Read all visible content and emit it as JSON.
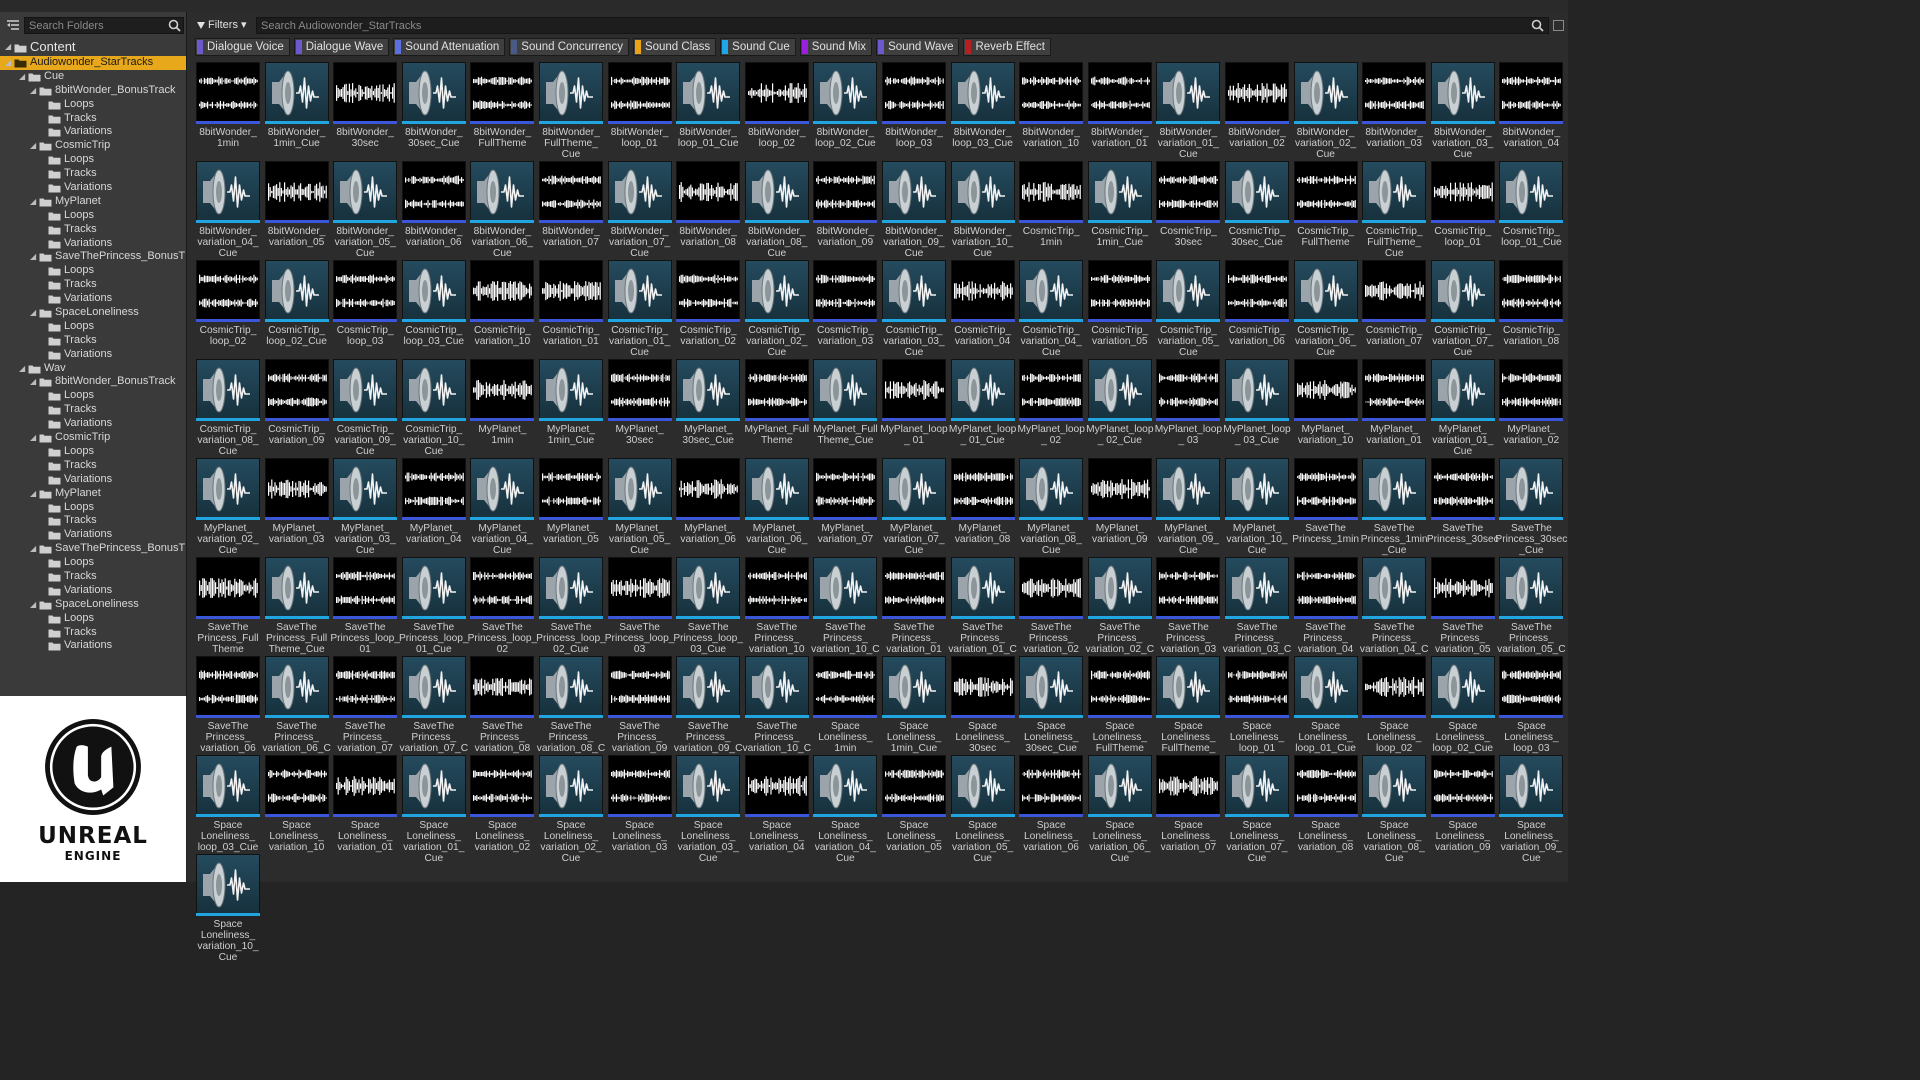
{
  "left_panel": {
    "search_placeholder": "Search Folders",
    "tree": [
      {
        "label": "Content",
        "level": 0,
        "expanded": true,
        "root": true
      },
      {
        "label": "Audiowonder_StarTracks",
        "level": 1,
        "expanded": true,
        "selected": true
      },
      {
        "label": "Cue",
        "level": 2,
        "expanded": true
      },
      {
        "label": "8bitWonder_BonusTrack",
        "level": 3,
        "expanded": true
      },
      {
        "label": "Loops",
        "level": 4
      },
      {
        "label": "Tracks",
        "level": 4
      },
      {
        "label": "Variations",
        "level": 4
      },
      {
        "label": "CosmicTrip",
        "level": 3,
        "expanded": true
      },
      {
        "label": "Loops",
        "level": 4
      },
      {
        "label": "Tracks",
        "level": 4
      },
      {
        "label": "Variations",
        "level": 4
      },
      {
        "label": "MyPlanet",
        "level": 3,
        "expanded": true
      },
      {
        "label": "Loops",
        "level": 4
      },
      {
        "label": "Tracks",
        "level": 4
      },
      {
        "label": "Variations",
        "level": 4
      },
      {
        "label": "SaveThePrincess_BonusT",
        "level": 3,
        "expanded": true
      },
      {
        "label": "Loops",
        "level": 4
      },
      {
        "label": "Tracks",
        "level": 4
      },
      {
        "label": "Variations",
        "level": 4
      },
      {
        "label": "SpaceLoneliness",
        "level": 3,
        "expanded": true
      },
      {
        "label": "Loops",
        "level": 4
      },
      {
        "label": "Tracks",
        "level": 4
      },
      {
        "label": "Variations",
        "level": 4
      },
      {
        "label": "Wav",
        "level": 2,
        "expanded": true
      },
      {
        "label": "8bitWonder_BonusTrack",
        "level": 3,
        "expanded": true
      },
      {
        "label": "Loops",
        "level": 4
      },
      {
        "label": "Tracks",
        "level": 4
      },
      {
        "label": "Variations",
        "level": 4
      },
      {
        "label": "CosmicTrip",
        "level": 3,
        "expanded": true
      },
      {
        "label": "Loops",
        "level": 4
      },
      {
        "label": "Tracks",
        "level": 4
      },
      {
        "label": "Variations",
        "level": 4
      },
      {
        "label": "MyPlanet",
        "level": 3,
        "expanded": true
      },
      {
        "label": "Loops",
        "level": 4
      },
      {
        "label": "Tracks",
        "level": 4
      },
      {
        "label": "Variations",
        "level": 4
      },
      {
        "label": "SaveThePrincess_BonusT",
        "level": 3,
        "expanded": true
      },
      {
        "label": "Loops",
        "level": 4
      },
      {
        "label": "Tracks",
        "level": 4
      },
      {
        "label": "Variations",
        "level": 4
      },
      {
        "label": "SpaceLoneliness",
        "level": 3,
        "expanded": true
      },
      {
        "label": "Loops",
        "level": 4
      },
      {
        "label": "Tracks",
        "level": 4
      },
      {
        "label": "Variations",
        "level": 4
      }
    ]
  },
  "logo": {
    "line1": "UNREAL",
    "line2": "ENGINE"
  },
  "toolbar": {
    "filters_label": "Filters",
    "search_placeholder": "Search Audiowonder_StarTracks"
  },
  "filter_chips": [
    {
      "label": "Dialogue Voice",
      "color": "#6a5acd"
    },
    {
      "label": "Dialogue Wave",
      "color": "#6a5acd"
    },
    {
      "label": "Sound Attenuation",
      "color": "#5b6fe0"
    },
    {
      "label": "Sound Concurrency",
      "color": "#4a5a86"
    },
    {
      "label": "Sound Class",
      "color": "#e8a317"
    },
    {
      "label": "Sound Cue",
      "color": "#1fa7e8"
    },
    {
      "label": "Sound Mix",
      "color": "#9b1fe0"
    },
    {
      "label": "Sound Wave",
      "color": "#6a5acd"
    },
    {
      "label": "Reverb Effect",
      "color": "#b41f1f"
    }
  ],
  "assets": [
    {
      "name": "8bitWonder_ 1min",
      "type": "wave"
    },
    {
      "name": "8bitWonder_ 1min_Cue",
      "type": "cue"
    },
    {
      "name": "8bitWonder_ 30sec",
      "type": "wave"
    },
    {
      "name": "8bitWonder_ 30sec_Cue",
      "type": "cue"
    },
    {
      "name": "8bitWonder_ FullTheme",
      "type": "wave"
    },
    {
      "name": "8bitWonder_ FullTheme_ Cue",
      "type": "cue"
    },
    {
      "name": "8bitWonder_ loop_01",
      "type": "wave"
    },
    {
      "name": "8bitWonder_ loop_01_Cue",
      "type": "cue"
    },
    {
      "name": "8bitWonder_ loop_02",
      "type": "wave"
    },
    {
      "name": "8bitWonder_ loop_02_Cue",
      "type": "cue"
    },
    {
      "name": "8bitWonder_ loop_03",
      "type": "wave"
    },
    {
      "name": "8bitWonder_ loop_03_Cue",
      "type": "cue"
    },
    {
      "name": "8bitWonder_ variation_10",
      "type": "wave"
    },
    {
      "name": "8bitWonder_ variation_01",
      "type": "wave"
    },
    {
      "name": "8bitWonder_ variation_01_ Cue",
      "type": "cue"
    },
    {
      "name": "8bitWonder_ variation_02",
      "type": "wave"
    },
    {
      "name": "8bitWonder_ variation_02_ Cue",
      "type": "cue"
    },
    {
      "name": "8bitWonder_ variation_03",
      "type": "wave"
    },
    {
      "name": "8bitWonder_ variation_03_ Cue",
      "type": "cue"
    },
    {
      "name": "8bitWonder_ variation_04",
      "type": "wave"
    },
    {
      "name": "8bitWonder_ variation_04_ Cue",
      "type": "cue"
    },
    {
      "name": "8bitWonder_ variation_05",
      "type": "wave"
    },
    {
      "name": "8bitWonder_ variation_05_ Cue",
      "type": "cue"
    },
    {
      "name": "8bitWonder_ variation_06",
      "type": "wave"
    },
    {
      "name": "8bitWonder_ variation_06_ Cue",
      "type": "cue"
    },
    {
      "name": "8bitWonder_ variation_07",
      "type": "wave"
    },
    {
      "name": "8bitWonder_ variation_07_ Cue",
      "type": "cue"
    },
    {
      "name": "8bitWonder_ variation_08",
      "type": "wave"
    },
    {
      "name": "8bitWonder_ variation_08_ Cue",
      "type": "cue"
    },
    {
      "name": "8bitWonder_ variation_09",
      "type": "wave"
    },
    {
      "name": "8bitWonder_ variation_09_ Cue",
      "type": "cue"
    },
    {
      "name": "8bitWonder_ variation_10_ Cue",
      "type": "cue"
    },
    {
      "name": "CosmicTrip_ 1min",
      "type": "wave"
    },
    {
      "name": "CosmicTrip_ 1min_Cue",
      "type": "cue"
    },
    {
      "name": "CosmicTrip_ 30sec",
      "type": "wave"
    },
    {
      "name": "CosmicTrip_ 30sec_Cue",
      "type": "cue"
    },
    {
      "name": "CosmicTrip_ FullTheme",
      "type": "wave"
    },
    {
      "name": "CosmicTrip_ FullTheme_ Cue",
      "type": "cue"
    },
    {
      "name": "CosmicTrip_ loop_01",
      "type": "wave"
    },
    {
      "name": "CosmicTrip_ loop_01_Cue",
      "type": "cue"
    },
    {
      "name": "CosmicTrip_ loop_02",
      "type": "wave"
    },
    {
      "name": "CosmicTrip_ loop_02_Cue",
      "type": "cue"
    },
    {
      "name": "CosmicTrip_ loop_03",
      "type": "wave"
    },
    {
      "name": "CosmicTrip_ loop_03_Cue",
      "type": "cue"
    },
    {
      "name": "CosmicTrip_ variation_10",
      "type": "wave"
    },
    {
      "name": "CosmicTrip_ variation_01",
      "type": "wave"
    },
    {
      "name": "CosmicTrip_ variation_01_ Cue",
      "type": "cue"
    },
    {
      "name": "CosmicTrip_ variation_02",
      "type": "wave"
    },
    {
      "name": "CosmicTrip_ variation_02_ Cue",
      "type": "cue"
    },
    {
      "name": "CosmicTrip_ variation_03",
      "type": "wave"
    },
    {
      "name": "CosmicTrip_ variation_03_ Cue",
      "type": "cue"
    },
    {
      "name": "CosmicTrip_ variation_04",
      "type": "wave"
    },
    {
      "name": "CosmicTrip_ variation_04_ Cue",
      "type": "cue"
    },
    {
      "name": "CosmicTrip_ variation_05",
      "type": "wave"
    },
    {
      "name": "CosmicTrip_ variation_05_ Cue",
      "type": "cue"
    },
    {
      "name": "CosmicTrip_ variation_06",
      "type": "wave"
    },
    {
      "name": "CosmicTrip_ variation_06_ Cue",
      "type": "cue"
    },
    {
      "name": "CosmicTrip_ variation_07",
      "type": "wave"
    },
    {
      "name": "CosmicTrip_ variation_07_ Cue",
      "type": "cue"
    },
    {
      "name": "CosmicTrip_ variation_08",
      "type": "wave"
    },
    {
      "name": "CosmicTrip_ variation_08_ Cue",
      "type": "cue"
    },
    {
      "name": "CosmicTrip_ variation_09",
      "type": "wave"
    },
    {
      "name": "CosmicTrip_ variation_09_ Cue",
      "type": "cue"
    },
    {
      "name": "CosmicTrip_ variation_10_ Cue",
      "type": "cue"
    },
    {
      "name": "MyPlanet_ 1min",
      "type": "wave"
    },
    {
      "name": "MyPlanet_ 1min_Cue",
      "type": "cue"
    },
    {
      "name": "MyPlanet_ 30sec",
      "type": "wave"
    },
    {
      "name": "MyPlanet_ 30sec_Cue",
      "type": "cue"
    },
    {
      "name": "MyPlanet_Full Theme",
      "type": "wave"
    },
    {
      "name": "MyPlanet_Full Theme_Cue",
      "type": "cue"
    },
    {
      "name": "MyPlanet_loop_ 01",
      "type": "wave"
    },
    {
      "name": "MyPlanet_loop_ 01_Cue",
      "type": "cue"
    },
    {
      "name": "MyPlanet_loop_ 02",
      "type": "wave"
    },
    {
      "name": "MyPlanet_loop_ 02_Cue",
      "type": "cue"
    },
    {
      "name": "MyPlanet_loop_ 03",
      "type": "wave"
    },
    {
      "name": "MyPlanet_loop_ 03_Cue",
      "type": "cue"
    },
    {
      "name": "MyPlanet_ variation_10",
      "type": "wave"
    },
    {
      "name": "MyPlanet_ variation_01",
      "type": "wave"
    },
    {
      "name": "MyPlanet_ variation_01_ Cue",
      "type": "cue"
    },
    {
      "name": "MyPlanet_ variation_02",
      "type": "wave"
    },
    {
      "name": "MyPlanet_ variation_02_ Cue",
      "type": "cue"
    },
    {
      "name": "MyPlanet_ variation_03",
      "type": "wave"
    },
    {
      "name": "MyPlanet_ variation_03_ Cue",
      "type": "cue"
    },
    {
      "name": "MyPlanet_ variation_04",
      "type": "wave"
    },
    {
      "name": "MyPlanet_ variation_04_ Cue",
      "type": "cue"
    },
    {
      "name": "MyPlanet_ variation_05",
      "type": "wave"
    },
    {
      "name": "MyPlanet_ variation_05_ Cue",
      "type": "cue"
    },
    {
      "name": "MyPlanet_ variation_06",
      "type": "wave"
    },
    {
      "name": "MyPlanet_ variation_06_ Cue",
      "type": "cue"
    },
    {
      "name": "MyPlanet_ variation_07",
      "type": "wave"
    },
    {
      "name": "MyPlanet_ variation_07_ Cue",
      "type": "cue"
    },
    {
      "name": "MyPlanet_ variation_08",
      "type": "wave"
    },
    {
      "name": "MyPlanet_ variation_08_ Cue",
      "type": "cue"
    },
    {
      "name": "MyPlanet_ variation_09",
      "type": "wave"
    },
    {
      "name": "MyPlanet_ variation_09_ Cue",
      "type": "cue"
    },
    {
      "name": "MyPlanet_ variation_10_ Cue",
      "type": "cue"
    },
    {
      "name": "SaveThe Princess_1min",
      "type": "wave"
    },
    {
      "name": "SaveThe Princess_1min _Cue",
      "type": "cue"
    },
    {
      "name": "SaveThe Princess_30sec",
      "type": "wave"
    },
    {
      "name": "SaveThe Princess_30sec _Cue",
      "type": "cue"
    },
    {
      "name": "SaveThe Princess_Full Theme",
      "type": "wave"
    },
    {
      "name": "SaveThe Princess_Full Theme_Cue",
      "type": "cue"
    },
    {
      "name": "SaveThe Princess_loop_ 01",
      "type": "wave"
    },
    {
      "name": "SaveThe Princess_loop_ 01_Cue",
      "type": "cue"
    },
    {
      "name": "SaveThe Princess_loop_ 02",
      "type": "wave"
    },
    {
      "name": "SaveThe Princess_loop_ 02_Cue",
      "type": "cue"
    },
    {
      "name": "SaveThe Princess_loop_ 03",
      "type": "wave"
    },
    {
      "name": "SaveThe Princess_loop_ 03_Cue",
      "type": "cue"
    },
    {
      "name": "SaveThe Princess_ variation_10",
      "type": "wave"
    },
    {
      "name": "SaveThe Princess_ variation_10_Cue",
      "type": "cue"
    },
    {
      "name": "SaveThe Princess_ variation_01",
      "type": "wave"
    },
    {
      "name": "SaveThe Princess_ variation_01_Cue",
      "type": "cue"
    },
    {
      "name": "SaveThe Princess_ variation_02",
      "type": "wave"
    },
    {
      "name": "SaveThe Princess_ variation_02_Cue",
      "type": "cue"
    },
    {
      "name": "SaveThe Princess_ variation_03",
      "type": "wave"
    },
    {
      "name": "SaveThe Princess_ variation_03_Cue",
      "type": "cue"
    },
    {
      "name": "SaveThe Princess_ variation_04",
      "type": "wave"
    },
    {
      "name": "SaveThe Princess_ variation_04_Cue",
      "type": "cue"
    },
    {
      "name": "SaveThe Princess_ variation_05",
      "type": "wave"
    },
    {
      "name": "SaveThe Princess_ variation_05_Cue",
      "type": "cue"
    },
    {
      "name": "SaveThe Princess_ variation_06",
      "type": "wave"
    },
    {
      "name": "SaveThe Princess_ variation_06_Cue",
      "type": "cue"
    },
    {
      "name": "SaveThe Princess_ variation_07",
      "type": "wave"
    },
    {
      "name": "SaveThe Princess_ variation_07_Cue",
      "type": "cue"
    },
    {
      "name": "SaveThe Princess_ variation_08",
      "type": "wave"
    },
    {
      "name": "SaveThe Princess_ variation_08_Cue",
      "type": "cue"
    },
    {
      "name": "SaveThe Princess_ variation_09",
      "type": "wave"
    },
    {
      "name": "SaveThe Princess_ variation_09_Cue",
      "type": "cue"
    },
    {
      "name": "SaveThe Princess_ variation_10_Cue",
      "type": "cue"
    },
    {
      "name": "Space Loneliness_ 1min",
      "type": "wave"
    },
    {
      "name": "Space Loneliness_ 1min_Cue",
      "type": "cue"
    },
    {
      "name": "Space Loneliness_ 30sec",
      "type": "wave"
    },
    {
      "name": "Space Loneliness_ 30sec_Cue",
      "type": "cue"
    },
    {
      "name": "Space Loneliness_ FullTheme",
      "type": "wave"
    },
    {
      "name": "Space Loneliness_ FullTheme_ Cue",
      "type": "cue"
    },
    {
      "name": "Space Loneliness_ loop_01",
      "type": "wave"
    },
    {
      "name": "Space Loneliness_ loop_01_Cue",
      "type": "cue"
    },
    {
      "name": "Space Loneliness_ loop_02",
      "type": "wave"
    },
    {
      "name": "Space Loneliness_ loop_02_Cue",
      "type": "cue"
    },
    {
      "name": "Space Loneliness_ loop_03",
      "type": "wave"
    },
    {
      "name": "Space Loneliness_ loop_03_Cue",
      "type": "cue"
    },
    {
      "name": "Space Loneliness_ variation_10",
      "type": "wave"
    },
    {
      "name": "Space Loneliness_ variation_01",
      "type": "wave"
    },
    {
      "name": "Space Loneliness_ variation_01_ Cue",
      "type": "cue"
    },
    {
      "name": "Space Loneliness_ variation_02",
      "type": "wave"
    },
    {
      "name": "Space Loneliness_ variation_02_ Cue",
      "type": "cue"
    },
    {
      "name": "Space Loneliness_ variation_03",
      "type": "wave"
    },
    {
      "name": "Space Loneliness_ variation_03_ Cue",
      "type": "cue"
    },
    {
      "name": "Space Loneliness_ variation_04",
      "type": "wave"
    },
    {
      "name": "Space Loneliness_ variation_04_ Cue",
      "type": "cue"
    },
    {
      "name": "Space Loneliness_ variation_05",
      "type": "wave"
    },
    {
      "name": "Space Loneliness_ variation_05_ Cue",
      "type": "cue"
    },
    {
      "name": "Space Loneliness_ variation_06",
      "type": "wave"
    },
    {
      "name": "Space Loneliness_ variation_06_ Cue",
      "type": "cue"
    },
    {
      "name": "Space Loneliness_ variation_07",
      "type": "wave"
    },
    {
      "name": "Space Loneliness_ variation_07_ Cue",
      "type": "cue"
    },
    {
      "name": "Space Loneliness_ variation_08",
      "type": "wave"
    },
    {
      "name": "Space Loneliness_ variation_08_ Cue",
      "type": "cue"
    },
    {
      "name": "Space Loneliness_ variation_09",
      "type": "wave"
    },
    {
      "name": "Space Loneliness_ variation_09_ Cue",
      "type": "cue"
    },
    {
      "name": "Space Loneliness_ variation_10_ Cue",
      "type": "cue"
    }
  ]
}
